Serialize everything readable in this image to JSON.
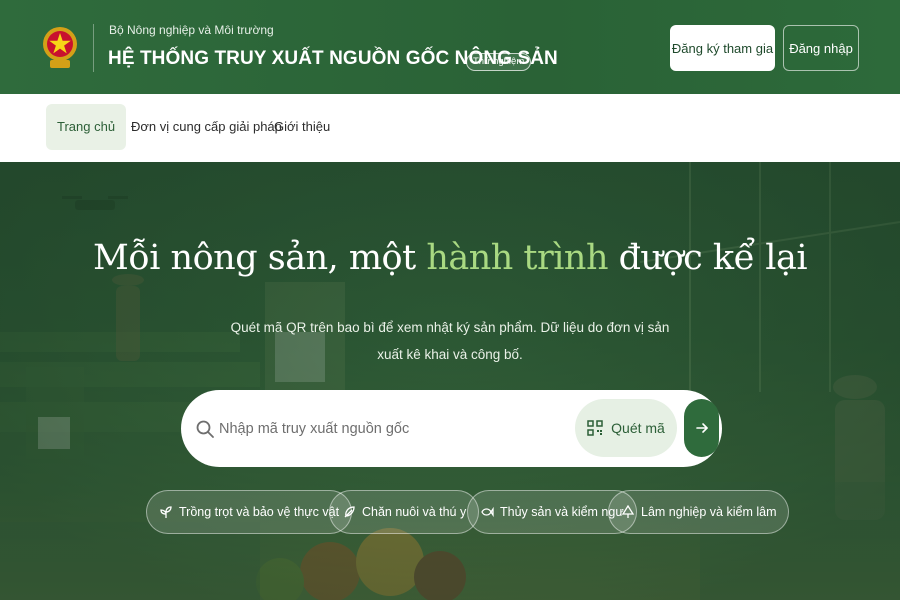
{
  "header": {
    "ministry": "Bộ Nông nghiệp và Môi trường",
    "system_title": "HỆ THỐNG TRUY XUẤT NGUỒN GỐC NÔNG SẢN",
    "badge": "Thử nghiệm",
    "register_label": "Đăng ký tham gia",
    "login_label": "Đăng nhập"
  },
  "nav": {
    "items": [
      {
        "label": "Trang chủ",
        "active": true
      },
      {
        "label": "Đơn vị cung cấp giải pháp",
        "active": false
      },
      {
        "label": "Giới thiệu",
        "active": false
      }
    ]
  },
  "hero": {
    "headline_before": "Mỗi nông sản, một ",
    "headline_accent": "hành trình",
    "headline_after": " được kể lại",
    "subtext": "Quét mã QR trên bao bì để xem nhật ký sản phẩm. Dữ liệu do đơn vị sản xuất kê khai và công bố.",
    "search": {
      "placeholder": "Nhập mã truy xuất nguồn gốc",
      "scan_label": "Quét mã"
    },
    "chips": [
      {
        "label": "Trồng trọt và bảo vệ thực vật",
        "icon": "sprout-icon"
      },
      {
        "label": "Chăn nuôi và thú y",
        "icon": "feather-icon"
      },
      {
        "label": "Thủy sản và kiểm ngư",
        "icon": "fish-icon"
      },
      {
        "label": "Lâm nghiệp và kiểm lâm",
        "icon": "tree-icon"
      }
    ]
  },
  "colors": {
    "brand_green": "#2f6b3c",
    "accent_light_green": "#a9d982",
    "nav_active_bg": "#e9f1e6"
  }
}
